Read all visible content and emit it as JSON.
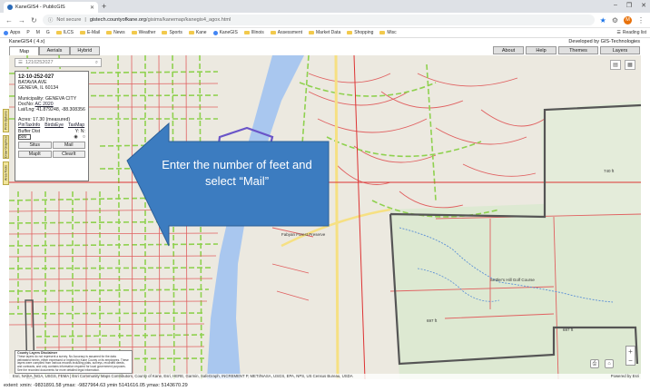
{
  "browser": {
    "tab_title": "KaneGIS4 - PublicGIS",
    "security_label": "Not secure",
    "url_domain": "gistech.countyofkane.org",
    "url_path": "/gisims/kanemap/kanegis4_agox.html",
    "profile_initial": "M",
    "bookmarks": [
      "Apps",
      "P",
      "M",
      "G",
      "ILCS",
      "E-Mail",
      "News",
      "Weather",
      "Sports",
      "Kane",
      "KaneGIS",
      "Illinois",
      "Assessment",
      "Market Data",
      "Shopping",
      "Misc"
    ],
    "reading_list": "Reading list"
  },
  "app": {
    "title": "KaneGIS4 ( 4.x)",
    "developer": "Developed by GIS-Technologies",
    "map_tabs": [
      "Map",
      "Aerials",
      "Hybrid"
    ],
    "right_tabs": [
      "About",
      "Help",
      "Themes",
      "Layers"
    ]
  },
  "search": {
    "value": "1210252027"
  },
  "popup": {
    "pin": "12-10-252-027",
    "address1": "BATAVIA AVE",
    "address2": "GENEVA, IL 60134",
    "municipality": "Municipality: GENEVA CITY",
    "docno_label": "DocNo:",
    "docno_link": "AC 2020",
    "latlng": "Lat/Lng: 41.879248, -88.308356",
    "acres": "Acres: 17.30 (measured)",
    "links": [
      "PinTaxInfo",
      "BirdsEye",
      "TaxMap"
    ],
    "buffer_label": "Buffer Dist",
    "yn": "Y:  N:",
    "buffer_value": "500",
    "buttons": [
      "Situs",
      "Mail",
      "MapIt",
      "ClearIt"
    ]
  },
  "side_tabs": [
    "Print Options",
    "Draw Graphics",
    "Area Tools"
  ],
  "annotation": {
    "text": "Enter the number of feet and select “Mail”",
    "color": "#3c7cc0"
  },
  "map_labels": [
    "Fabyan Forest Preserve",
    "Settler's Hill Golf Course",
    "740 ft",
    "697 ft",
    "697 ft"
  ],
  "disclaimer": {
    "heading": "County Layers Disclaimer",
    "body": "These layers do not represent a survey. No Accuracy is assumed for the data delineated herein, either expressed or implied by Kane County or its employees. These layers were compiled from various records including plats, surveys, recorded deeds, and contracts, and only contains information required for local government purposes. See the recorded documents for more detailed legal information."
  },
  "attribution": "Esri, NASA, NGA, USGS, FEMA | Esri Community Maps Contributors, County of Kane, Esri, HERE, Garmin, SafeGraph, INCREMENT P, METI/NASA, USGS, EPA, NPS, US Census Bureau, USDA",
  "powered_by": "Powered by Esri",
  "status": "extent: xmin: -9831891.58 ymax: -9827964.63 ymin 5141616.05 ymax: 5143670.29",
  "colors": {
    "road": "#e63333",
    "street": "#8fd14f",
    "river": "#a9c7ef",
    "boundary": "#555555",
    "parcel": "#6a55c8"
  }
}
